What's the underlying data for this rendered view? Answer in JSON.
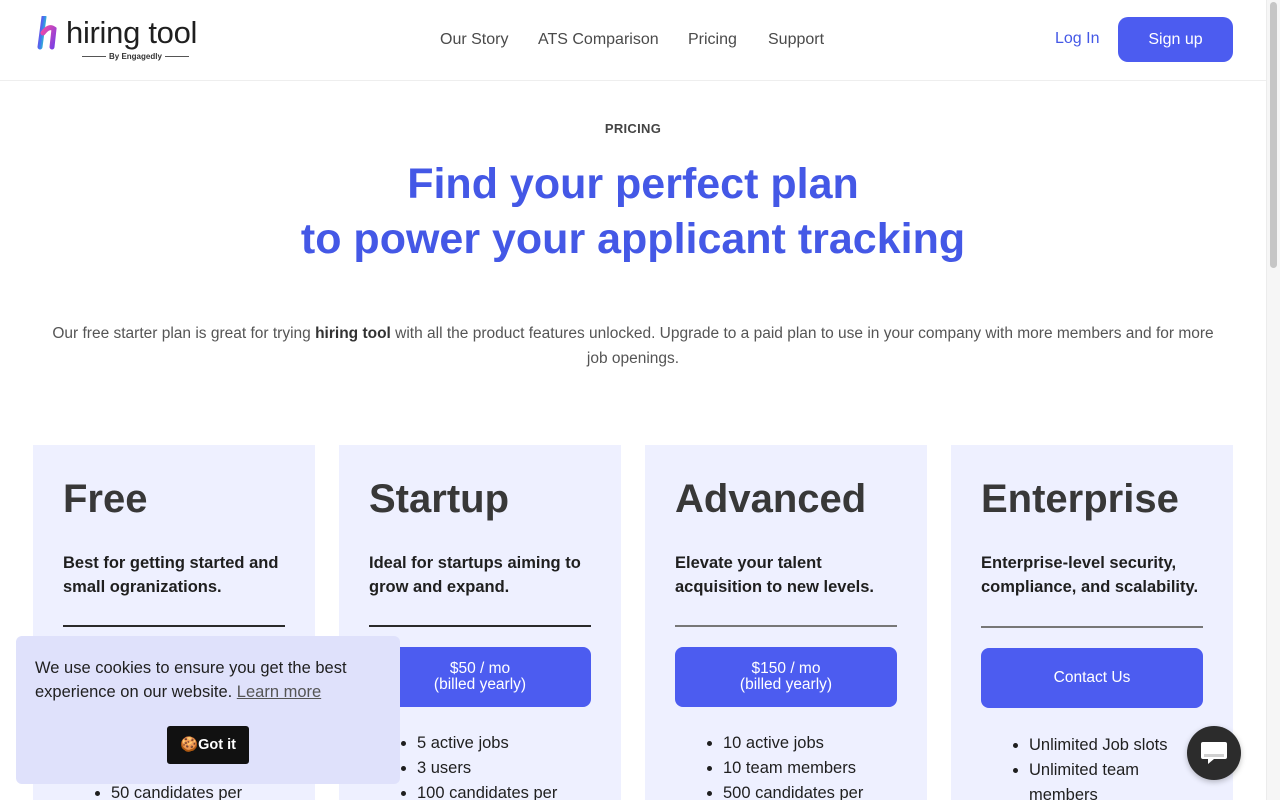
{
  "header": {
    "logo_text": "hiring tool",
    "logo_sub": "By Engagedly",
    "nav": [
      "Our Story",
      "ATS Comparison",
      "Pricing",
      "Support"
    ],
    "login": "Log In",
    "signup": "Sign up"
  },
  "hero": {
    "eyebrow": "PRICING",
    "headline_line1": "Find your perfect plan",
    "headline_line2": "to power your applicant tracking",
    "intro_pre": "Our free starter plan is great for trying ",
    "intro_bold": "hiring tool",
    "intro_post": " with all the product features unlocked. Upgrade to a paid plan to use in your company with more members and for more job openings."
  },
  "plans": [
    {
      "name": "Free",
      "desc": "Best for getting started and small ogranizations.",
      "button": [
        "",
        ""
      ],
      "features": [
        "",
        "",
        "50 candidates per"
      ]
    },
    {
      "name": "Startup",
      "desc": "Ideal for startups aiming to grow and expand.",
      "button": [
        "$50 / mo",
        "(billed yearly)"
      ],
      "features": [
        "5 active jobs",
        "3 users",
        "100 candidates per"
      ]
    },
    {
      "name": "Advanced",
      "desc": "Elevate your talent acquisition to new levels.",
      "button": [
        "$150 / mo",
        "(billed yearly)"
      ],
      "features": [
        "10 active jobs",
        "10 team members",
        "500 candidates per"
      ]
    },
    {
      "name": "Enterprise",
      "desc": "Enterprise-level security, compliance, and scalability.",
      "button": [
        "Contact Us",
        ""
      ],
      "features": [
        "Unlimited Job slots",
        "Unlimited team members"
      ]
    }
  ],
  "cookie": {
    "text": "We use cookies to ensure you get the best experience on our website.",
    "link": "Learn more",
    "button": "Got it",
    "button_icon": "🍪"
  },
  "icons": {
    "logo": "h-logo-icon",
    "chat": "chat-bubble-icon"
  },
  "colors": {
    "accent": "#4c5cf0",
    "headline": "#4458e6",
    "card_bg": "#eef0ff",
    "cookie_bg": "#dfe1fb"
  }
}
